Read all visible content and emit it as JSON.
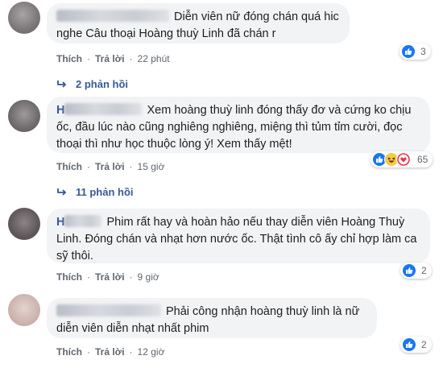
{
  "comments": [
    {
      "name_prefix": "",
      "text": "Diễn viên nữ đóng chán quá hic nghe Câu thoại Hoàng thuỳ Linh đã chán r",
      "actions": {
        "like": "Thích",
        "reply": "Trả lời",
        "time": "22 phút"
      },
      "reactions": {
        "icons": [
          "like-icon"
        ],
        "count": "3"
      },
      "replies": "2 phản hồi"
    },
    {
      "name_prefix": "H",
      "text": "Xem hoàng thuỳ linh đóng thấy đơ và cứng ko chịu ốc, đầu lúc nào cũng nghiêng nghiêng, miệng thì tủm tỉm cười, đọc thoại thì như học thuộc lòng ý! Xem thấy mệt!",
      "actions": {
        "like": "Thích",
        "reply": "Trả lời",
        "time": "15 giờ"
      },
      "reactions": {
        "icons": [
          "like-icon",
          "haha-icon",
          "love-icon"
        ],
        "count": "65"
      },
      "replies": "11 phản hồi"
    },
    {
      "name_prefix": "H",
      "text": "Phim rất hay và hoàn hảo nếu thay diễn viên Hoàng Thuỳ Linh. Đóng chán và nhạt hơn nước ốc. Thật tình cô ấy chỉ hợp làm ca sỹ thôi.",
      "actions": {
        "like": "Thích",
        "reply": "Trả lời",
        "time": "9 giờ"
      },
      "reactions": {
        "icons": [
          "like-icon"
        ],
        "count": "2"
      },
      "replies": ""
    },
    {
      "name_prefix": "",
      "text": "Phải công nhận hoàng thuỳ linh là nữ diễn viên diễn nhạt nhất phim",
      "actions": {
        "like": "Thích",
        "reply": "Trả lời",
        "time": "12 giờ"
      },
      "reactions": {
        "icons": [
          "like-icon"
        ],
        "count": "2"
      },
      "replies": ""
    }
  ],
  "colors": {
    "bubble": "#f2f3f5",
    "link": "#385898",
    "meta": "#606770",
    "like": "#1877f2"
  }
}
